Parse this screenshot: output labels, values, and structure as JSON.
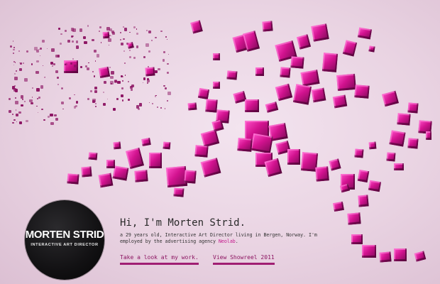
{
  "profile": {
    "logo_name": "MORTEN STRID",
    "logo_subtitle": "INTERACTIVE ART DIRECTOR",
    "headline": "Hi, I'm Morten Strid.",
    "bio_prefix": "a 29 years old, Interactive Art Director living in Bergen, Norway. I'm employed by the advertising agency ",
    "agency": "Neolab",
    "bio_suffix": "."
  },
  "links": {
    "work": "Take a look at my work.",
    "showreel": "View Showreel 2011"
  },
  "colors": {
    "background": "#ead6e4",
    "accent": "#d2128f",
    "link": "#8c1461"
  }
}
